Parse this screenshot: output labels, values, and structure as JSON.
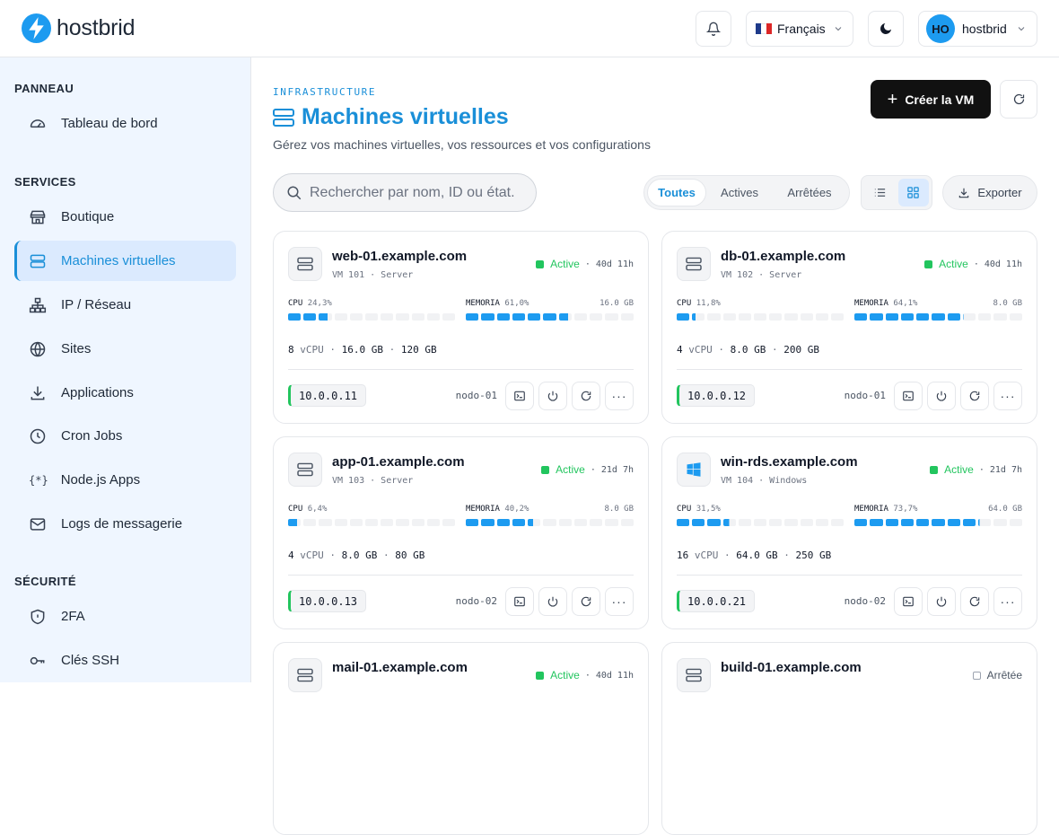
{
  "header": {
    "brand": "hostbrid",
    "language": "Français",
    "user_initials": "HO",
    "user_name": "hostbrid"
  },
  "sidebar": {
    "sections": [
      {
        "label": "PANNEAU",
        "items": [
          {
            "label": "Tableau de bord",
            "icon": "dashboard-gauge-icon"
          }
        ]
      },
      {
        "label": "SERVICES",
        "items": [
          {
            "label": "Boutique",
            "icon": "store-icon"
          },
          {
            "label": "Machines virtuelles",
            "icon": "server-icon",
            "active": true
          },
          {
            "label": "IP / Réseau",
            "icon": "network-icon"
          },
          {
            "label": "Sites",
            "icon": "globe-icon"
          },
          {
            "label": "Applications",
            "icon": "download-icon"
          },
          {
            "label": "Cron Jobs",
            "icon": "clock-icon"
          },
          {
            "label": "Node.js Apps",
            "icon": "code-braces-icon"
          },
          {
            "label": "Logs de messagerie",
            "icon": "mail-icon"
          }
        ]
      },
      {
        "label": "SÉCURITÉ",
        "items": [
          {
            "label": "2FA",
            "icon": "shield-icon"
          },
          {
            "label": "Clés SSH",
            "icon": "key-icon"
          }
        ]
      }
    ]
  },
  "page": {
    "eyebrow": "INFRASTRUCTURE",
    "title": "Machines virtuelles",
    "subtitle": "Gérez vos machines virtuelles, vos ressources et vos configurations",
    "create_label": "Créer la VM",
    "search_placeholder": "Rechercher par nom, ID ou état.",
    "filters": [
      "Toutes",
      "Actives",
      "Arrêtées"
    ],
    "active_filter": "Toutes",
    "export_label": "Exporter"
  },
  "labels": {
    "cpu": "CPU",
    "memory": "MEMORIA",
    "vcpu": "vCPU"
  },
  "colors": {
    "accent": "#1a8fd8",
    "active": "#22c55e",
    "bar": "#1d9bf0",
    "stopped": "#9ca3af"
  },
  "vms": [
    {
      "name": "web-01.example.com",
      "meta": "VM 101 · Server",
      "os": "server",
      "status": "Active",
      "uptime": "40d 11h",
      "cpu_label": "24,3%",
      "cpu": 24.3,
      "mem_label": "61,0%",
      "mem": 61.0,
      "mem_total": "16.0 GB",
      "vcpu": "8",
      "ram": "16.0 GB",
      "disk": "120 GB",
      "ip": "10.0.0.11",
      "node": "nodo-01"
    },
    {
      "name": "db-01.example.com",
      "meta": "VM 102 · Server",
      "os": "server",
      "status": "Active",
      "uptime": "40d 11h",
      "cpu_label": "11,8%",
      "cpu": 11.8,
      "mem_label": "64,1%",
      "mem": 64.1,
      "mem_total": "8.0 GB",
      "vcpu": "4",
      "ram": "8.0 GB",
      "disk": "200 GB",
      "ip": "10.0.0.12",
      "node": "nodo-01"
    },
    {
      "name": "app-01.example.com",
      "meta": "VM 103 · Server",
      "os": "server",
      "status": "Active",
      "uptime": "21d 7h",
      "cpu_label": "6,4%",
      "cpu": 6.4,
      "mem_label": "40,2%",
      "mem": 40.2,
      "mem_total": "8.0 GB",
      "vcpu": "4",
      "ram": "8.0 GB",
      "disk": "80 GB",
      "ip": "10.0.0.13",
      "node": "nodo-02"
    },
    {
      "name": "win-rds.example.com",
      "meta": "VM 104 · Windows",
      "os": "windows",
      "status": "Active",
      "uptime": "21d 7h",
      "cpu_label": "31,5%",
      "cpu": 31.5,
      "mem_label": "73,7%",
      "mem": 73.7,
      "mem_total": "64.0 GB",
      "vcpu": "16",
      "ram": "64.0 GB",
      "disk": "250 GB",
      "ip": "10.0.0.21",
      "node": "nodo-02"
    },
    {
      "name": "mail-01.example.com",
      "os": "server",
      "status": "Active",
      "uptime": "40d 11h"
    },
    {
      "name": "build-01.example.com",
      "os": "server",
      "status": "Arrêtée",
      "uptime": ""
    }
  ]
}
